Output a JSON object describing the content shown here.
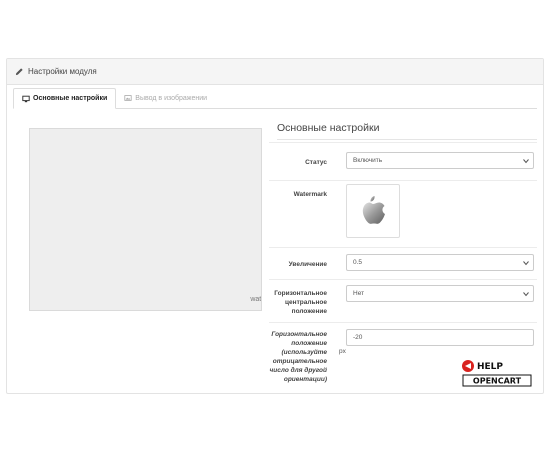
{
  "panel": {
    "heading": "Настройки модуля"
  },
  "tabs": [
    {
      "label": "Основные настройки",
      "active": true
    },
    {
      "label": "Вывод в изображении",
      "active": false
    }
  ],
  "preview": {
    "watermark_text": "watermark"
  },
  "settings": {
    "title": "Основные настройки",
    "status": {
      "label": "Статус",
      "value": "Включить"
    },
    "watermark": {
      "label": "Watermark",
      "image_icon": "apple-logo-icon"
    },
    "zoom": {
      "label": "Увеличение",
      "value": "0.5"
    },
    "hcenter": {
      "label": "Горизонтальное центральное положение",
      "value": "Нет"
    },
    "hpos": {
      "label": "Горизонтальное положение (используйте отрицательное число для другой ориентации)",
      "value": "-20",
      "unit": "px"
    }
  },
  "logo": {
    "line1": "HELP",
    "line2": "OPENCART"
  },
  "colors": {
    "accent_red": "#d9231f",
    "panel_bg": "#f5f5f5",
    "preview_bg": "#eeeeee"
  }
}
